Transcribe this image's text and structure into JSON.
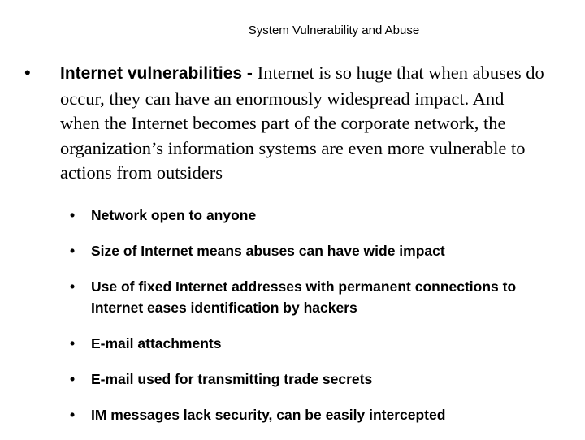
{
  "slide": {
    "title": "System Vulnerability and Abuse",
    "main_bullet": {
      "bullet_glyph": "•",
      "lead": "Internet vulnerabilities - ",
      "body": "Internet is so huge that when abuses do occur, they can have an enormously widespread impact. And when the Internet becomes part of the corporate network, the organization’s information systems are even more vulnerable to actions from outsiders"
    },
    "sub_bullets": [
      {
        "glyph": "•",
        "text": "Network open to anyone"
      },
      {
        "glyph": "•",
        "text": "Size of Internet means abuses can have wide impact"
      },
      {
        "glyph": "•",
        "text": "Use of fixed Internet addresses with permanent connections to Internet eases identification by hackers"
      },
      {
        "glyph": "•",
        "text": "E-mail attachments"
      },
      {
        "glyph": "•",
        "text": "E-mail used for transmitting trade secrets"
      },
      {
        "glyph": "•",
        "text": "IM messages lack security, can be easily intercepted"
      }
    ]
  }
}
